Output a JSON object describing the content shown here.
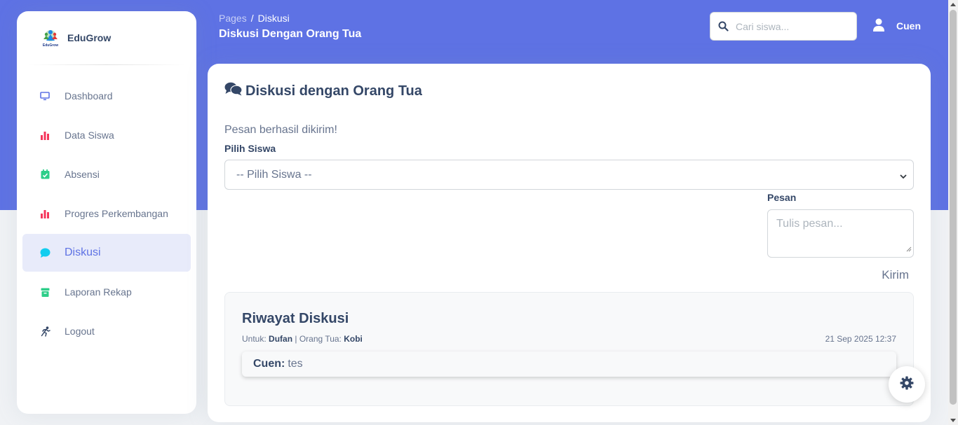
{
  "sidebar": {
    "brand_name": "EduGrow",
    "logo_caption": "EduGrow",
    "items": [
      {
        "label": "Dashboard",
        "icon": "tv-icon",
        "color": "#5e72e4"
      },
      {
        "label": "Data Siswa",
        "icon": "bar-chart-icon",
        "color": "#f5365c"
      },
      {
        "label": "Absensi",
        "icon": "calendar-check-icon",
        "color": "#2dce89"
      },
      {
        "label": "Progres Perkembangan",
        "icon": "bar-chart-icon",
        "color": "#f5365c"
      },
      {
        "label": "Diskusi",
        "icon": "chat-bubble-icon",
        "color": "#11cdef",
        "active": true
      },
      {
        "label": "Laporan Rekap",
        "icon": "archive-icon",
        "color": "#2dce89"
      },
      {
        "label": "Logout",
        "icon": "running-icon",
        "color": "#344767"
      }
    ]
  },
  "header": {
    "breadcrumb_root": "Pages",
    "breadcrumb_sep": "/",
    "breadcrumb_current": "Diskusi",
    "title": "Diskusi Dengan Orang Tua",
    "search_placeholder": "Cari siswa...",
    "user_name": "Cuen"
  },
  "main": {
    "card_title": "Diskusi dengan Orang Tua",
    "flash_message": "Pesan berhasil dikirim!",
    "select_label": "Pilih Siswa",
    "select_value": "-- Pilih Siswa --",
    "message_label": "Pesan",
    "message_placeholder": "Tulis pesan...",
    "send_label": "Kirim"
  },
  "history": {
    "title": "Riwayat Diskusi",
    "for_label": "Untuk:",
    "student": "Dufan",
    "separator": "|",
    "parent_label": "Orang Tua:",
    "parent": "Kobi",
    "timestamp": "21 Sep 2025 12:37",
    "sender": "Cuen:",
    "text": "tes"
  },
  "colors": {
    "primary": "#5e72e4",
    "background": "#f0f2f5"
  }
}
